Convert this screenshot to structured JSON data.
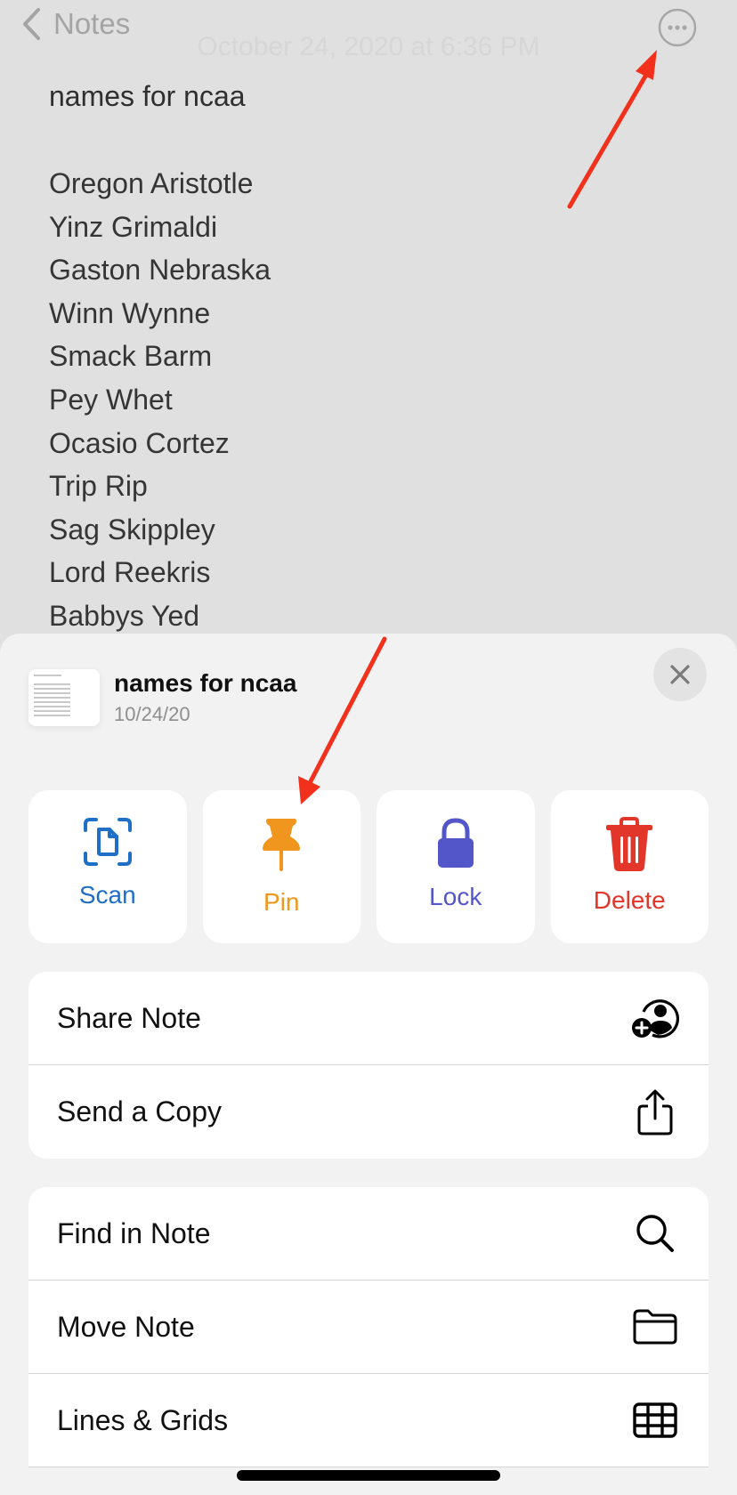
{
  "nav": {
    "back_label": "Notes",
    "more_icon": "ellipsis-circle-icon"
  },
  "note": {
    "date": "October 24, 2020 at 6:36 PM",
    "title": "names for ncaa",
    "lines": [
      "Oregon Aristotle",
      "Yinz Grimaldi",
      "Gaston Nebraska",
      "Winn Wynne",
      "Smack Barm",
      "Pey Whet",
      "Ocasio Cortez",
      "Trip Rip",
      "Sag Skippley",
      "Lord Reekris",
      "Babbys Yed"
    ]
  },
  "sheet": {
    "title": "names for ncaa",
    "date": "10/24/20",
    "close_icon": "close-icon",
    "actions": [
      {
        "label": "Scan",
        "icon": "scan-document-icon",
        "color": "#1f6fc6"
      },
      {
        "label": "Pin",
        "icon": "pin-icon",
        "color": "#f0951d"
      },
      {
        "label": "Lock",
        "icon": "lock-icon",
        "color": "#5356c9"
      },
      {
        "label": "Delete",
        "icon": "trash-icon",
        "color": "#e2362b"
      }
    ],
    "group1": [
      {
        "label": "Share Note",
        "icon": "person-add-circle-icon"
      },
      {
        "label": "Send a Copy",
        "icon": "share-icon"
      }
    ],
    "group2": [
      {
        "label": "Find in Note",
        "icon": "search-icon"
      },
      {
        "label": "Move Note",
        "icon": "folder-icon"
      },
      {
        "label": "Lines & Grids",
        "icon": "grid-icon"
      }
    ]
  },
  "annotation_color": "#f2311d"
}
